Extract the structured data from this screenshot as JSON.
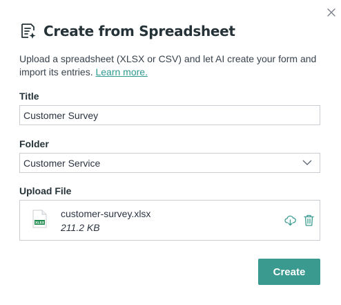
{
  "dialog": {
    "title": "Create from Spreadsheet",
    "description": "Upload a spreadsheet (XLSX or CSV) and let AI create your form and import its entries.",
    "learn_more": "Learn more.",
    "close_icon": "close-icon",
    "header_icon": "spreadsheet-ai-icon"
  },
  "form": {
    "title_label": "Title",
    "title_value": "Customer Survey",
    "folder_label": "Folder",
    "folder_value": "Customer Service",
    "upload_label": "Upload File"
  },
  "file": {
    "name": "customer-survey.xlsx",
    "size": "211.2 KB",
    "type_badge": "XLSX",
    "icons": [
      "file-xlsx-icon",
      "cloud-download-icon",
      "trash-icon"
    ]
  },
  "actions": {
    "create_label": "Create"
  },
  "colors": {
    "accent": "#3a9a8f",
    "link": "#2f9a91",
    "heading": "#253238"
  }
}
